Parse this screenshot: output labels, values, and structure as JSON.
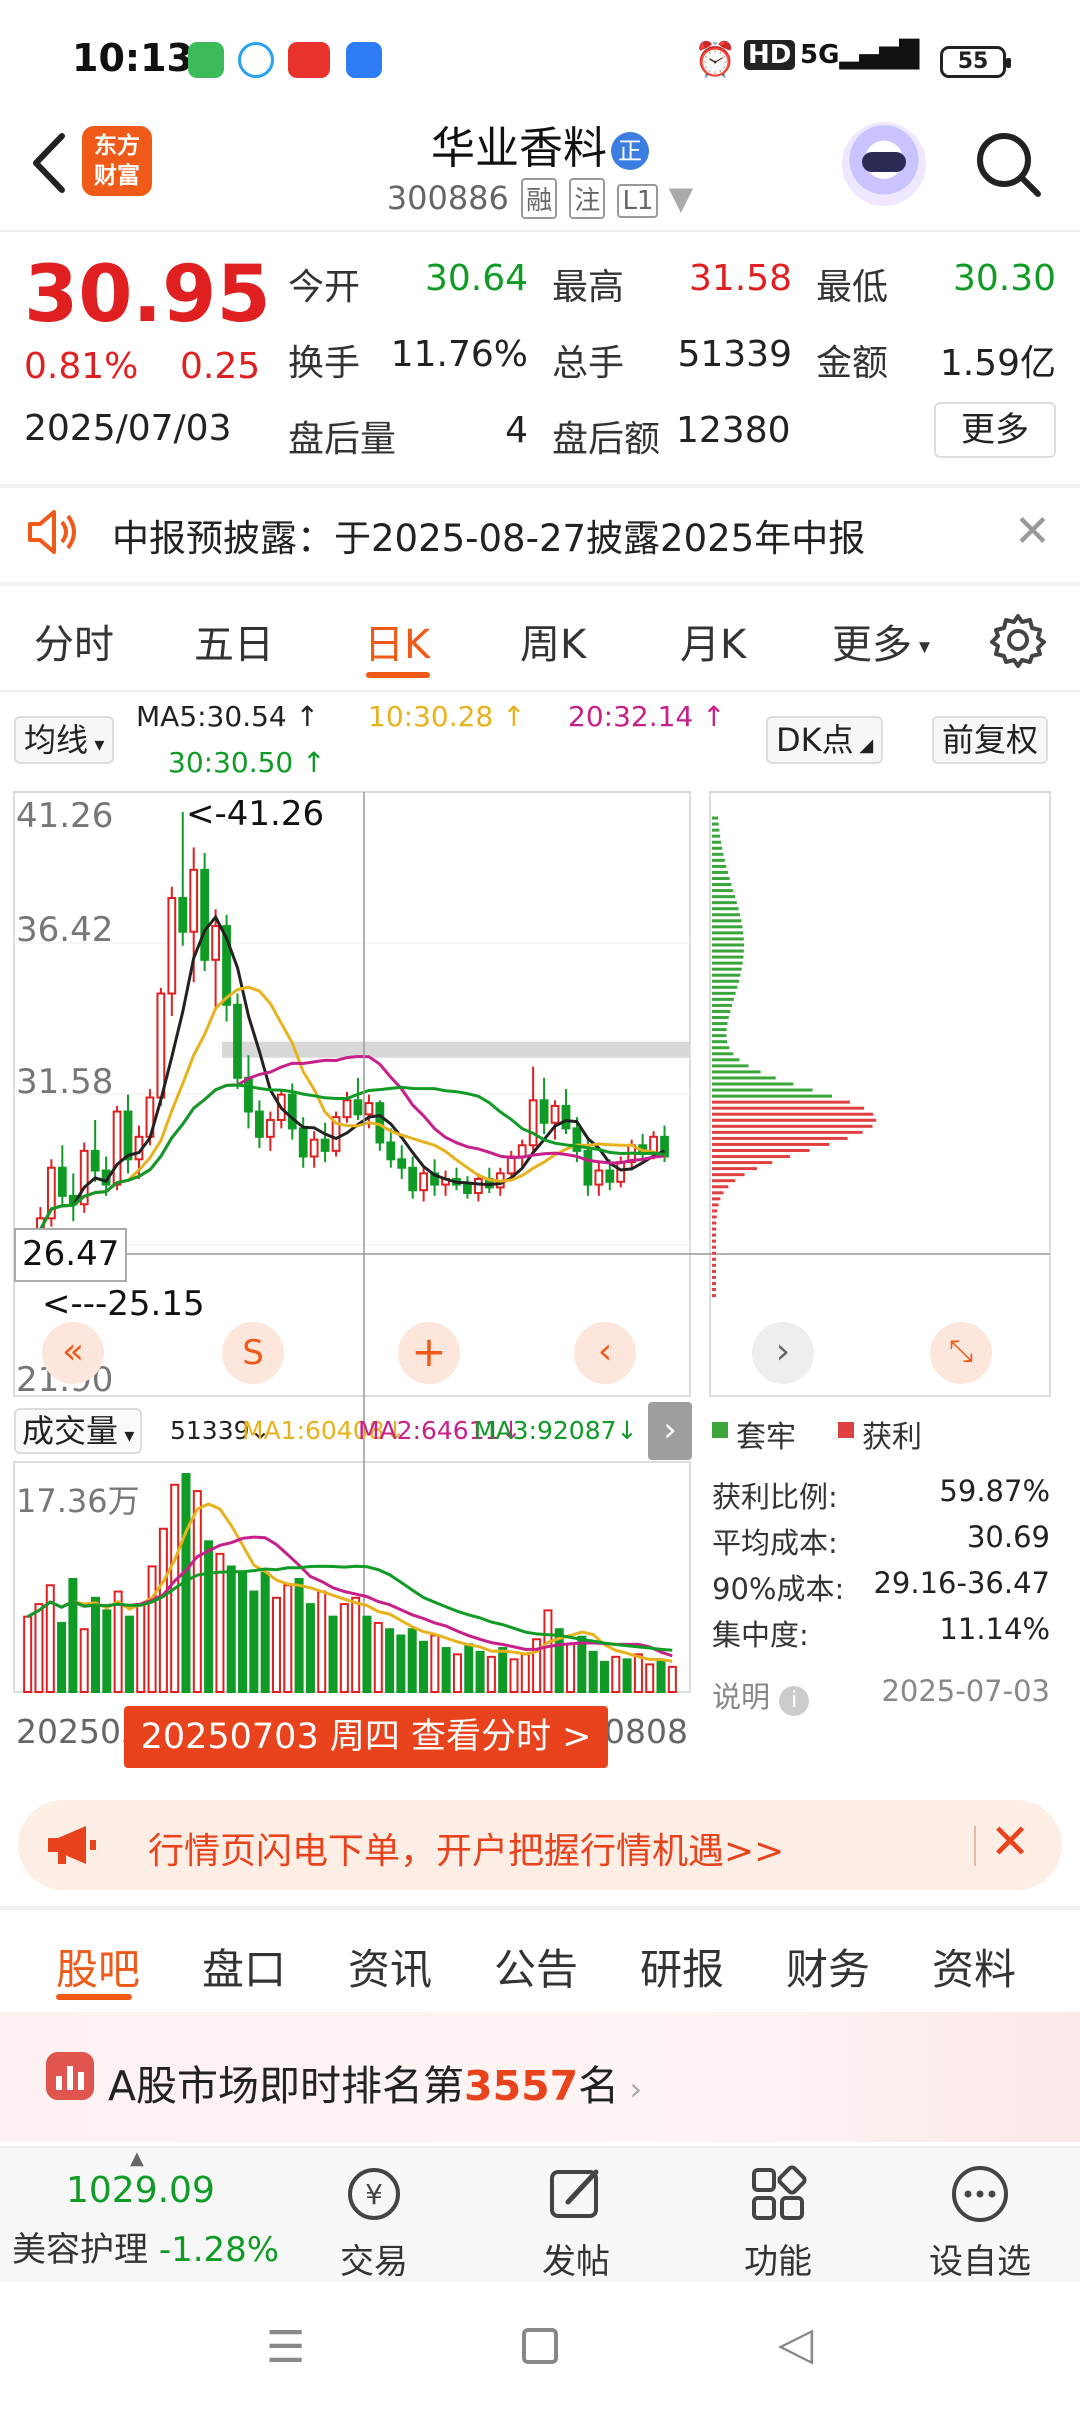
{
  "status_bar": {
    "time": "10:13",
    "hd": "HD",
    "signal1": "5G",
    "signal2": "5G",
    "battery": "55"
  },
  "header": {
    "back_label": "返回",
    "logo_text_line1": "东方",
    "logo_text_line2": "财富",
    "stock_name": "华业香料",
    "name_badge": "正",
    "stock_code": "300886",
    "tag_rong": "融",
    "tag_zhu": "注",
    "tag_level": "L1"
  },
  "quote": {
    "price": "30.95",
    "change_pct": "0.81%",
    "change_amt": "0.25",
    "date": "2025/07/03",
    "open_label": "今开",
    "open": "30.64",
    "high_label": "最高",
    "high": "31.58",
    "low_label": "最低",
    "low": "30.30",
    "turnover_label": "换手",
    "turnover": "11.76%",
    "volume_label": "总手",
    "volume": "51339",
    "amount_label": "金额",
    "amount": "1.59亿",
    "after_vol_label": "盘后量",
    "after_vol": "4",
    "after_amt_label": "盘后额",
    "after_amt": "12380",
    "more_button": "更多"
  },
  "notice": {
    "text": "中报预披露：于2025-08-27披露2025年中报"
  },
  "chart_tabs": [
    "分时",
    "五日",
    "日K",
    "周K",
    "月K",
    "更多"
  ],
  "chart_tabs_active": 2,
  "indicator_bar": {
    "ma_selector": "均线",
    "ma5": "MA5:30.54",
    "ma10": "10:30.28",
    "ma20": "20:32.14",
    "ma30": "30:30.50",
    "dk_button": "DK点",
    "fq_button": "前复权"
  },
  "kline": {
    "y_ticks": [
      "41.26",
      "36.42",
      "31.58",
      "26.47",
      "21.90"
    ],
    "high_marker": "<-41.26",
    "low_marker": "<---25.15",
    "crosshair_price": "26.47"
  },
  "volume": {
    "selector": "成交量",
    "vol": "51339",
    "ma1": "MA1:60408",
    "ma2": "MA2:64611",
    "ma3": "MA3:92087",
    "y_tick": "17.36万",
    "x_left": "202505",
    "x_right": "0808",
    "date_banner": "20250703 周四 查看分时 >"
  },
  "chip_panel": {
    "legend_loss": "套牢",
    "legend_profit": "获利",
    "stats": [
      {
        "label": "获利比例:",
        "value": "59.87%"
      },
      {
        "label": "平均成本:",
        "value": "30.69"
      },
      {
        "label": "90%成本:",
        "value": "29.16-36.47"
      },
      {
        "label": "集中度:",
        "value": "11.14%"
      }
    ],
    "explain": "说明",
    "date": "2025-07-03"
  },
  "promo": {
    "text": "行情页闪电下单，开户把握行情机遇>>"
  },
  "bottom_tabs": [
    "股吧",
    "盘口",
    "资讯",
    "公告",
    "研报",
    "财务",
    "资料"
  ],
  "bottom_tabs_active": 0,
  "rank": {
    "prefix": "A股市场即时排名第",
    "number": "3557",
    "suffix": "名"
  },
  "bottom_bar": {
    "index_value": "1029.09",
    "index_name": "美容护理",
    "index_change": "-1.28%",
    "trade": "交易",
    "post": "发帖",
    "function": "功能",
    "watchlist": "设自选"
  },
  "colors": {
    "accent": "#ef5a19",
    "up": "#e02020",
    "down": "#0f9b25"
  },
  "chart_data": {
    "type": "candlestick",
    "ylim": [
      21.9,
      41.26
    ],
    "candles": [
      {
        "o": 25.2,
        "h": 26.4,
        "l": 24.9,
        "c": 26.0
      },
      {
        "o": 26.0,
        "h": 27.2,
        "l": 25.6,
        "c": 26.8
      },
      {
        "o": 26.8,
        "h": 28.9,
        "l": 26.5,
        "c": 28.6
      },
      {
        "o": 28.6,
        "h": 29.4,
        "l": 27.2,
        "c": 27.6
      },
      {
        "o": 27.6,
        "h": 28.4,
        "l": 26.7,
        "c": 27.3
      },
      {
        "o": 27.3,
        "h": 29.5,
        "l": 27.0,
        "c": 29.2
      },
      {
        "o": 29.2,
        "h": 30.3,
        "l": 28.1,
        "c": 28.5
      },
      {
        "o": 28.5,
        "h": 29.0,
        "l": 27.6,
        "c": 28.0
      },
      {
        "o": 28.0,
        "h": 30.8,
        "l": 27.8,
        "c": 30.6
      },
      {
        "o": 30.6,
        "h": 31.2,
        "l": 28.4,
        "c": 28.9
      },
      {
        "o": 28.9,
        "h": 30.1,
        "l": 28.2,
        "c": 29.7
      },
      {
        "o": 29.7,
        "h": 31.4,
        "l": 29.4,
        "c": 31.1
      },
      {
        "o": 31.1,
        "h": 35.0,
        "l": 30.8,
        "c": 34.8
      },
      {
        "o": 34.8,
        "h": 38.6,
        "l": 34.0,
        "c": 38.2
      },
      {
        "o": 38.2,
        "h": 41.26,
        "l": 36.5,
        "c": 37.0
      },
      {
        "o": 37.0,
        "h": 40.0,
        "l": 35.2,
        "c": 39.2
      },
      {
        "o": 39.2,
        "h": 39.8,
        "l": 35.6,
        "c": 36.0
      },
      {
        "o": 36.0,
        "h": 37.8,
        "l": 34.2,
        "c": 37.2
      },
      {
        "o": 37.2,
        "h": 37.6,
        "l": 33.8,
        "c": 34.4
      },
      {
        "o": 34.4,
        "h": 34.8,
        "l": 31.4,
        "c": 31.8
      },
      {
        "o": 31.8,
        "h": 32.6,
        "l": 30.0,
        "c": 30.6
      },
      {
        "o": 30.6,
        "h": 31.0,
        "l": 29.3,
        "c": 29.7
      },
      {
        "o": 29.7,
        "h": 30.6,
        "l": 29.2,
        "c": 30.3
      },
      {
        "o": 30.3,
        "h": 31.4,
        "l": 30.0,
        "c": 31.2
      },
      {
        "o": 31.2,
        "h": 31.6,
        "l": 29.6,
        "c": 30.0
      },
      {
        "o": 30.0,
        "h": 30.4,
        "l": 28.6,
        "c": 29.0
      },
      {
        "o": 29.0,
        "h": 29.9,
        "l": 28.6,
        "c": 29.6
      },
      {
        "o": 29.6,
        "h": 30.2,
        "l": 28.8,
        "c": 29.2
      },
      {
        "o": 29.2,
        "h": 30.6,
        "l": 29.0,
        "c": 30.4
      },
      {
        "o": 30.4,
        "h": 31.3,
        "l": 30.2,
        "c": 31.0
      },
      {
        "o": 31.0,
        "h": 31.8,
        "l": 30.3,
        "c": 30.5
      },
      {
        "o": 30.5,
        "h": 31.2,
        "l": 30.0,
        "c": 30.9
      },
      {
        "o": 30.9,
        "h": 31.0,
        "l": 29.2,
        "c": 29.5
      },
      {
        "o": 29.5,
        "h": 30.0,
        "l": 28.6,
        "c": 28.9
      },
      {
        "o": 28.9,
        "h": 29.4,
        "l": 28.2,
        "c": 28.6
      },
      {
        "o": 28.6,
        "h": 29.0,
        "l": 27.5,
        "c": 27.8
      },
      {
        "o": 27.8,
        "h": 28.6,
        "l": 27.4,
        "c": 28.4
      },
      {
        "o": 28.4,
        "h": 28.9,
        "l": 27.6,
        "c": 28.0
      },
      {
        "o": 28.0,
        "h": 28.5,
        "l": 27.6,
        "c": 28.2
      },
      {
        "o": 28.2,
        "h": 28.6,
        "l": 27.8,
        "c": 28.0
      },
      {
        "o": 28.0,
        "h": 28.3,
        "l": 27.5,
        "c": 27.7
      },
      {
        "o": 27.7,
        "h": 28.4,
        "l": 27.4,
        "c": 28.2
      },
      {
        "o": 28.2,
        "h": 28.6,
        "l": 27.7,
        "c": 27.9
      },
      {
        "o": 27.9,
        "h": 28.6,
        "l": 27.6,
        "c": 28.4
      },
      {
        "o": 28.4,
        "h": 29.2,
        "l": 28.2,
        "c": 29.0
      },
      {
        "o": 29.0,
        "h": 29.6,
        "l": 28.6,
        "c": 29.4
      },
      {
        "o": 29.4,
        "h": 32.2,
        "l": 29.2,
        "c": 31.0
      },
      {
        "o": 31.0,
        "h": 31.8,
        "l": 29.8,
        "c": 30.2
      },
      {
        "o": 30.2,
        "h": 31.0,
        "l": 29.6,
        "c": 30.8
      },
      {
        "o": 30.8,
        "h": 31.4,
        "l": 29.8,
        "c": 30.0
      },
      {
        "o": 30.0,
        "h": 30.4,
        "l": 28.8,
        "c": 29.2
      },
      {
        "o": 29.2,
        "h": 29.6,
        "l": 27.6,
        "c": 28.0
      },
      {
        "o": 28.0,
        "h": 28.8,
        "l": 27.6,
        "c": 28.5
      },
      {
        "o": 28.5,
        "h": 28.9,
        "l": 27.8,
        "c": 28.1
      },
      {
        "o": 28.1,
        "h": 29.0,
        "l": 27.9,
        "c": 28.8
      },
      {
        "o": 28.8,
        "h": 29.6,
        "l": 28.6,
        "c": 29.4
      },
      {
        "o": 29.4,
        "h": 29.8,
        "l": 28.9,
        "c": 29.1
      },
      {
        "o": 29.1,
        "h": 29.9,
        "l": 28.9,
        "c": 29.7
      },
      {
        "o": 29.7,
        "h": 30.1,
        "l": 28.8,
        "c": 29.0
      }
    ],
    "volumes": [
      6.0,
      7.0,
      8.5,
      5.5,
      9.0,
      5.0,
      7.5,
      6.5,
      8.0,
      6.0,
      7.0,
      10.0,
      13.0,
      16.5,
      17.36,
      16.0,
      12.0,
      11.0,
      10.0,
      9.5,
      8.0,
      9.5,
      7.5,
      8.5,
      9.0,
      7.0,
      8.0,
      6.0,
      7.0,
      7.5,
      6.0,
      5.5,
      5.0,
      4.5,
      5.0,
      4.0,
      4.5,
      3.5,
      3.0,
      3.8,
      3.2,
      2.8,
      3.5,
      2.6,
      3.0,
      4.2,
      6.5,
      5.0,
      3.8,
      4.4,
      3.2,
      2.4,
      2.8,
      2.6,
      3.0,
      2.2,
      2.4,
      2.0
    ],
    "chip_distribution": {
      "profit_ratio": "59.87%",
      "avg_cost": "30.69",
      "cost_90": "29.16-36.47",
      "concentration": "11.14%"
    }
  }
}
